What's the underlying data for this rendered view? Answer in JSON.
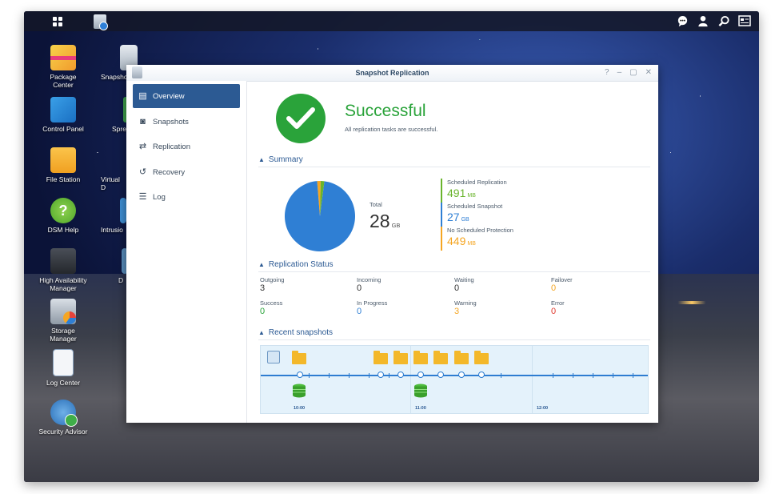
{
  "desktop": {
    "icons": [
      {
        "label": "Package\nCenter"
      },
      {
        "label": "Snapsho"
      },
      {
        "label": "Control Panel"
      },
      {
        "label": "Spre"
      },
      {
        "label": "File Station"
      },
      {
        "label": "Virtual D"
      },
      {
        "label": "DSM Help"
      },
      {
        "label": "Intrusio"
      },
      {
        "label": "High Availability\nManager"
      },
      {
        "label": "D"
      },
      {
        "label": "Storage\nManager"
      },
      {
        "label": "Log Center"
      },
      {
        "label": "Security Advisor"
      }
    ]
  },
  "window": {
    "title": "Snapshot Replication",
    "controls": [
      "?",
      "–",
      "▢",
      "✕"
    ]
  },
  "sidebar": {
    "items": [
      {
        "label": "Overview",
        "icon": "overview-icon",
        "active": true
      },
      {
        "label": "Snapshots",
        "icon": "camera-icon"
      },
      {
        "label": "Replication",
        "icon": "replication-icon"
      },
      {
        "label": "Recovery",
        "icon": "recovery-icon"
      },
      {
        "label": "Log",
        "icon": "log-icon"
      }
    ]
  },
  "status": {
    "title": "Successful",
    "subtitle": "All replication tasks are successful."
  },
  "summary": {
    "heading": "Summary",
    "total_label": "Total",
    "total_value": "28",
    "total_unit": "GB",
    "legend": [
      {
        "name": "Scheduled Replication",
        "value": "491",
        "unit": "MB",
        "color": "#6ab42d"
      },
      {
        "name": "Scheduled Snapshot",
        "value": "27",
        "unit": "GB",
        "color": "#2f7fd4"
      },
      {
        "name": "No Scheduled Protection",
        "value": "449",
        "unit": "MB",
        "color": "#f5a623"
      }
    ],
    "pie_fractions": [
      0.017,
      0.967,
      0.016
    ]
  },
  "replication_status": {
    "heading": "Replication Status",
    "cells": [
      {
        "label": "Outgoing",
        "value": "3",
        "color": "#333333"
      },
      {
        "label": "Incoming",
        "value": "0",
        "color": "#333333"
      },
      {
        "label": "Waiting",
        "value": "0",
        "color": "#333333"
      },
      {
        "label": "Failover",
        "value": "0",
        "color": "#f5a623"
      },
      {
        "label": "Success",
        "value": "0",
        "color": "#2aa33a"
      },
      {
        "label": "In Progress",
        "value": "0",
        "color": "#2f7fd4"
      },
      {
        "label": "Warning",
        "value": "3",
        "color": "#f5a623"
      },
      {
        "label": "Error",
        "value": "0",
        "color": "#e03b2f"
      }
    ]
  },
  "recent_snapshots": {
    "heading": "Recent snapshots",
    "times": [
      "10:00",
      "11:00",
      "12:00"
    ]
  }
}
